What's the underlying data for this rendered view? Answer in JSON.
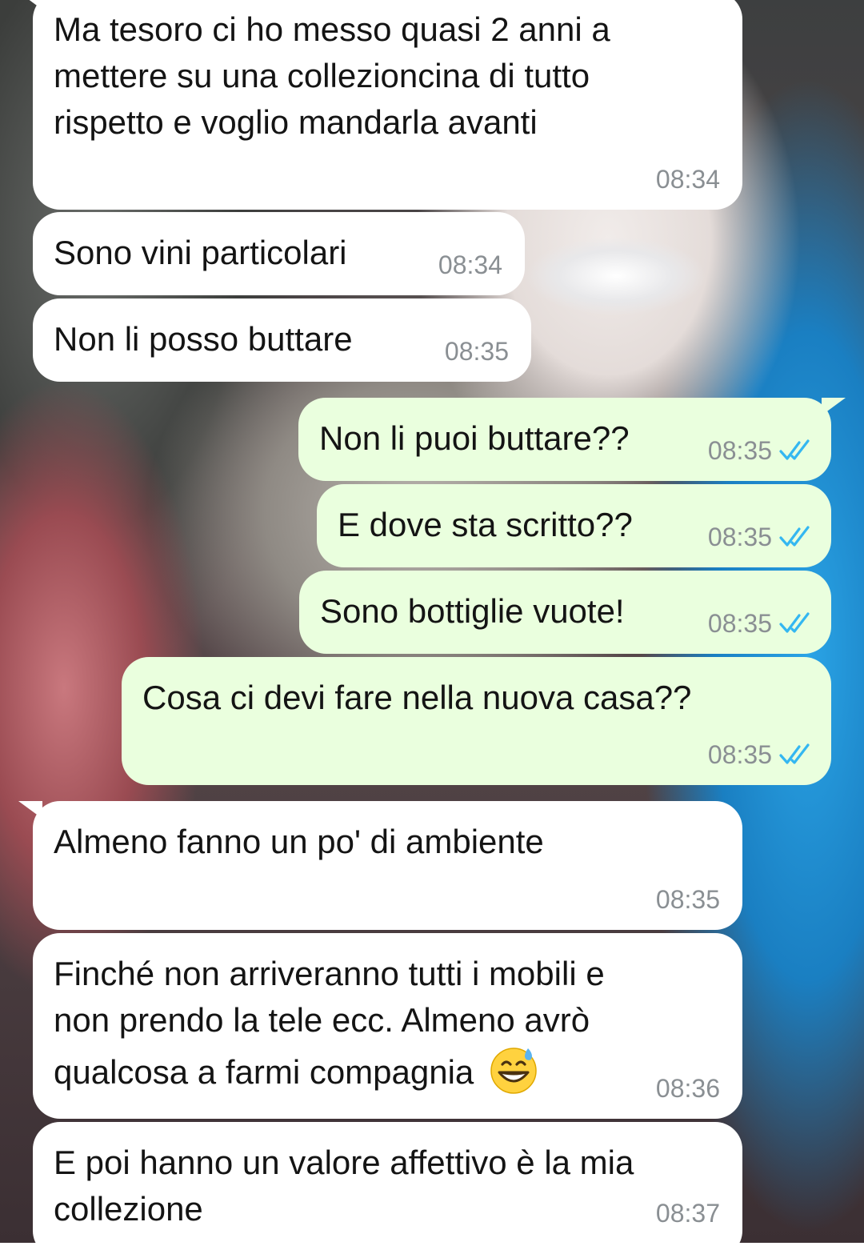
{
  "chat": {
    "messages": [
      {
        "direction": "in",
        "text": "Ma tesoro ci ho messo quasi 2 anni a\nmettere su una collezioncina di tutto\nrispetto e voglio mandarla avanti",
        "time": "08:34"
      },
      {
        "direction": "in",
        "text": "Sono vini particolari",
        "time": "08:34"
      },
      {
        "direction": "in",
        "text": "Non li posso buttare",
        "time": "08:35"
      },
      {
        "direction": "out",
        "text": "Non li puoi buttare??",
        "time": "08:35",
        "status": "read"
      },
      {
        "direction": "out",
        "text": "E dove sta scritto??",
        "time": "08:35",
        "status": "read"
      },
      {
        "direction": "out",
        "text": "Sono bottiglie vuote!",
        "time": "08:35",
        "status": "read"
      },
      {
        "direction": "out",
        "text": "Cosa ci devi fare nella nuova casa??",
        "time": "08:35",
        "status": "read"
      },
      {
        "direction": "in",
        "text": "Almeno fanno un po' di ambiente",
        "time": "08:35"
      },
      {
        "direction": "in",
        "text": "Finché non arriveranno tutti i mobili e\nnon prendo la tele ecc. Almeno avrò\nqualcosa a farmi compagnia",
        "emoji": "grinning-sweat-emoji",
        "time": "08:36"
      },
      {
        "direction": "in",
        "text": "E poi hanno un valore affettivo è la mia\ncollezione",
        "time": "08:37"
      }
    ]
  },
  "colors": {
    "incoming_bubble": "#ffffff",
    "outgoing_bubble": "#eaffde",
    "timestamp": "#8a8f93",
    "read_ticks": "#34b7f1"
  }
}
